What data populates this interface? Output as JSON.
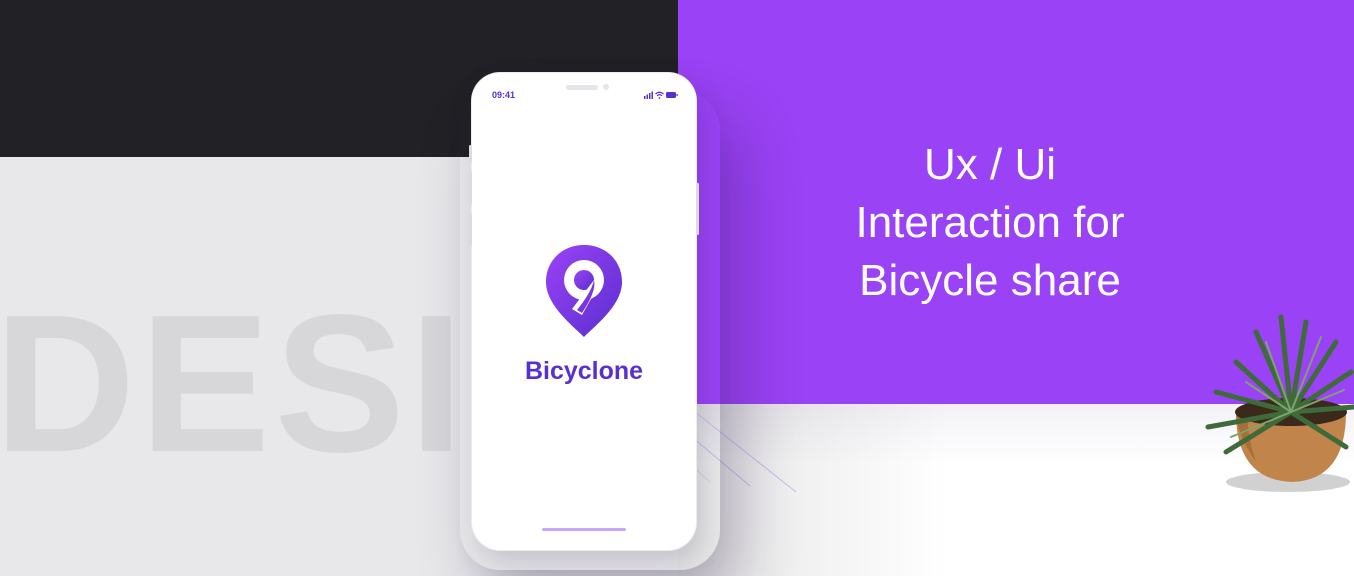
{
  "phone": {
    "status_time": "09:41",
    "app_name": "Bicyclone"
  },
  "headline": {
    "line1": "Ux / Ui",
    "line2": "Interaction for",
    "line3": "Bicycle share"
  },
  "watermark": "DESIGN",
  "colors": {
    "accent_purple": "#9a42f5",
    "brand_purple": "#5a2fd0",
    "dark_panel": "#222126",
    "grey_panel": "#e8e8ea"
  },
  "icons": {
    "logo": "location-pin-icon",
    "signal": "signal-icon",
    "wifi": "wifi-icon",
    "battery": "battery-icon",
    "plant": "potted-plant"
  }
}
